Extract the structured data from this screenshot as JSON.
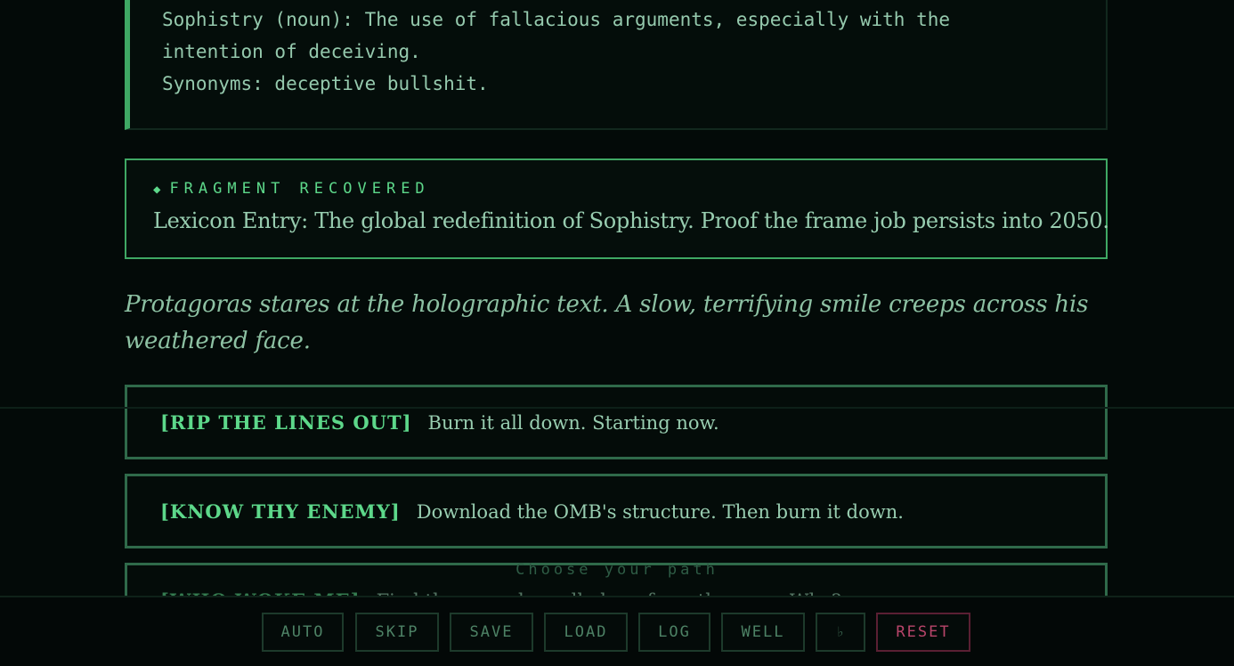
{
  "lexicon_quote": {
    "lines": [
      "Sophistry (noun): The use of fallacious arguments, especially with the",
      "intention of deceiving.",
      "Synonyms: deceptive bullshit."
    ]
  },
  "fragment": {
    "icon": "diamond-icon",
    "heading": "FRAGMENT RECOVERED",
    "text": "Lexicon Entry: The global redefinition of Sophistry. Proof the frame job persists into 2050."
  },
  "narration": {
    "lines": [
      "Protagoras stares at the holographic text. A slow, terrifying smile creeps across his",
      "weathered face."
    ]
  },
  "choices": [
    {
      "tag": "[RIP THE LINES OUT]",
      "text": "Burn it all down. Starting now."
    },
    {
      "tag": "[KNOW THY ENEMY]",
      "text": "Download the OMB's structure. Then burn it down."
    },
    {
      "tag": "[WHO WOKE ME]",
      "text": "Find the one who pulled me from the ooze. Why?"
    }
  ],
  "choose_prompt": "Choose your path",
  "toolbar": {
    "auto": "AUTO",
    "skip": "SKIP",
    "save": "SAVE",
    "load": "LOAD",
    "log": "LOG",
    "well": "WELL",
    "flat": "♭",
    "reset": "RESET"
  },
  "colors": {
    "background": "#030a08",
    "accent_green": "#5dd88a",
    "border_green": "#3fa864",
    "reset_red": "#b8456a"
  }
}
